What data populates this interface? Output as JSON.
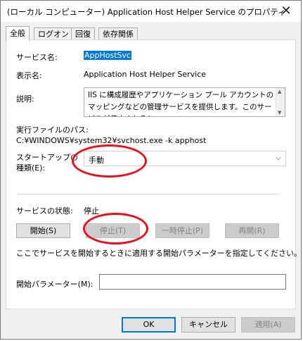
{
  "window": {
    "title": "(ローカル コンピューター) Application Host Helper Service のプロパティ",
    "close_icon": "close-icon"
  },
  "tabs": [
    {
      "label": "全般",
      "active": true
    },
    {
      "label": "ログオン",
      "active": false
    },
    {
      "label": "回復",
      "active": false
    },
    {
      "label": "依存関係",
      "active": false
    }
  ],
  "general": {
    "service_name_label": "サービス名:",
    "service_name_value": "AppHostSvc",
    "display_name_label": "表示名:",
    "display_name_value": "Application Host Helper Service",
    "description_label": "説明:",
    "description_text": "IIS に構成履歴やアプリケーション プール アカウントのマッピングなどの管理サービスを提供します。このサービスが停止されると",
    "exec_path_label": "実行ファイルのパス:",
    "exec_path_value": "C:¥WINDOWS¥system32¥svchost.exe -k apphost",
    "startup_type_label_line1": "スタートアップの",
    "startup_type_label_line2": "種類(E):",
    "startup_type_value": "手動",
    "status_label": "サービスの状態:",
    "status_value": "停止",
    "buttons": {
      "start": "開始(S)",
      "stop": "停止(T)",
      "pause": "一時停止(P)",
      "resume": "再開(R)"
    },
    "params_hint": "ここでサービスを開始するときに適用する開始パラメーターを指定してください。",
    "params_label": "開始パラメーター(M):",
    "params_value": ""
  },
  "footer": {
    "ok": "OK",
    "cancel": "キャンセル",
    "apply": "適用(A)"
  },
  "annotation_color": "#e8101c"
}
